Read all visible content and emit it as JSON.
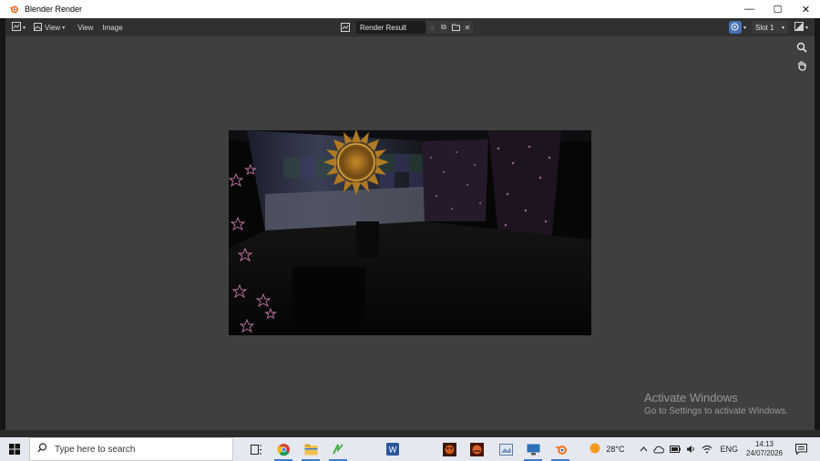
{
  "window": {
    "title": "Blender Render",
    "controls": {
      "minimize": "—",
      "maximize": "☐",
      "close": "✕"
    }
  },
  "header": {
    "editor_type_icon": "image-editor-icon",
    "view_dropdown": "View",
    "menus": [
      "View",
      "Image"
    ],
    "image_name": "Render Result",
    "slot": "Slot 1"
  },
  "viewport": {
    "background": "#3f3f3f",
    "render_image": "render-result-image"
  },
  "watermark": {
    "title": "Activate Windows",
    "subtitle": "Go to Settings to activate Windows."
  },
  "taskbar": {
    "search_placeholder": "Type here to search",
    "weather": "28°C",
    "language": "ENG",
    "time": "14:13",
    "date": "24/07/2026",
    "apps": [
      "task-view-icon",
      "chrome-icon",
      "file-explorer-icon",
      "app-green-icon",
      "word-icon",
      "game-icon-1",
      "game-icon-2",
      "image-viewer-icon",
      "remote-desktop-icon",
      "blender-icon"
    ]
  }
}
